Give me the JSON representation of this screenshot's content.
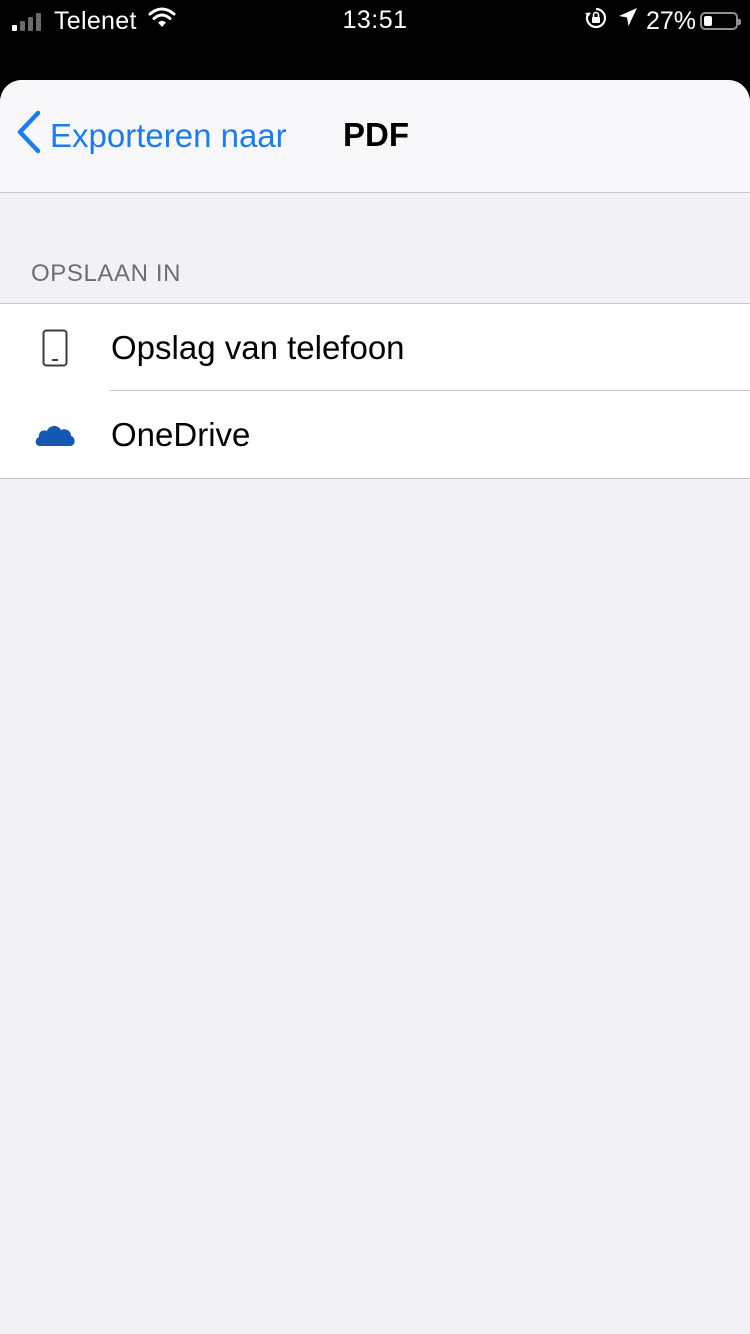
{
  "status_bar": {
    "carrier": "Telenet",
    "time": "13:51",
    "battery_percent": "27%",
    "battery_level": 0.27,
    "signal_bars_filled": 1,
    "signal_bars_total": 4,
    "icons": [
      "signal-icon",
      "wifi-icon",
      "rotation-lock-icon",
      "location-arrow-icon",
      "battery-icon"
    ]
  },
  "nav": {
    "back_label": "Exporteren naar",
    "title": "PDF",
    "back_icon": "chevron-left-icon",
    "accent_color": "#1a7cf0"
  },
  "section": {
    "header": "OPSLAAN IN",
    "items": [
      {
        "label": "Opslag van telefoon",
        "icon": "phone-icon"
      },
      {
        "label": "OneDrive",
        "icon": "onedrive-cloud-icon",
        "icon_color": "#1557b5"
      }
    ]
  }
}
